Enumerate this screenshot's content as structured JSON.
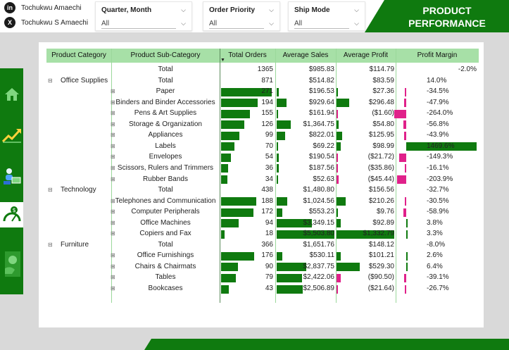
{
  "social": [
    {
      "icon": "linkedin-icon",
      "glyph": "in",
      "name": "Tochukwu Amaechi"
    },
    {
      "icon": "x-icon",
      "glyph": "X",
      "name": "Tochukwu S Amaechi"
    }
  ],
  "slicers": [
    {
      "title": "Quarter, Month",
      "value": "All"
    },
    {
      "title": "Order Priority",
      "value": "All"
    },
    {
      "title": "Ship Mode",
      "value": "All"
    }
  ],
  "banner": {
    "line1": "PRODUCT",
    "line2": "PERFORMANCE"
  },
  "nav": [
    "home-icon",
    "trend-up-icon",
    "customer-icon",
    "speedometer-icon",
    "profit-icon"
  ],
  "colors": {
    "accent": "#0f7a0f",
    "header": "#a7e0a7",
    "negative_bar": "#e0218a"
  },
  "table": {
    "columns": [
      "Product Category",
      "Product Sub-Category",
      "Total Orders",
      "Average Sales",
      "Average Profit",
      "Profit Margin"
    ],
    "sorted_column": "Total Orders",
    "rows": [
      {
        "cat": "",
        "exp": "",
        "sub": "Total",
        "orders": "1365",
        "sales": "$985.83",
        "profit": "$114.79",
        "margin": "-2.0%",
        "kind": "grand"
      },
      {
        "cat": "Office Supplies",
        "exp": "⊟",
        "sub": "Total",
        "orders": "871",
        "sales": "$514.82",
        "profit": "$83.59",
        "margin": "14.0%",
        "kind": "total"
      },
      {
        "cat": "",
        "exp": "⊞",
        "sub": "Paper",
        "orders": "271",
        "sales": "$196.53",
        "profit": "$27.36",
        "margin": "-34.5%",
        "kind": "item",
        "o": 271,
        "s": 196.53,
        "p": 27.36,
        "m": -34.5
      },
      {
        "cat": "",
        "exp": "⊞",
        "sub": "Binders and Binder Accessories",
        "orders": "194",
        "sales": "$929.64",
        "profit": "$296.48",
        "margin": "-47.9%",
        "kind": "item",
        "o": 194,
        "s": 929.64,
        "p": 296.48,
        "m": -47.9
      },
      {
        "cat": "",
        "exp": "⊞",
        "sub": "Pens & Art Supplies",
        "orders": "155",
        "sales": "$161.94",
        "profit": "($1.60)",
        "margin": "-264.0%",
        "kind": "item",
        "o": 155,
        "s": 161.94,
        "p": -1.6,
        "m": -264.0
      },
      {
        "cat": "",
        "exp": "⊞",
        "sub": "Storage & Organization",
        "orders": "126",
        "sales": "$1,364.75",
        "profit": "$54.80",
        "margin": "-56.8%",
        "kind": "item",
        "o": 126,
        "s": 1364.75,
        "p": 54.8,
        "m": -56.8
      },
      {
        "cat": "",
        "exp": "⊞",
        "sub": "Appliances",
        "orders": "99",
        "sales": "$822.01",
        "profit": "$125.95",
        "margin": "-43.9%",
        "kind": "item",
        "o": 99,
        "s": 822.01,
        "p": 125.95,
        "m": -43.9
      },
      {
        "cat": "",
        "exp": "⊞",
        "sub": "Labels",
        "orders": "70",
        "sales": "$69.22",
        "profit": "$98.99",
        "margin": "1469.6%",
        "kind": "item",
        "o": 70,
        "s": 69.22,
        "p": 98.99,
        "m": 1469.6
      },
      {
        "cat": "",
        "exp": "⊞",
        "sub": "Envelopes",
        "orders": "54",
        "sales": "$190.54",
        "profit": "($21.72)",
        "margin": "-149.3%",
        "kind": "item",
        "o": 54,
        "s": 190.54,
        "p": -21.72,
        "m": -149.3
      },
      {
        "cat": "",
        "exp": "⊞",
        "sub": "Scissors, Rulers and Trimmers",
        "orders": "36",
        "sales": "$187.56",
        "profit": "($35.86)",
        "margin": "-16.1%",
        "kind": "item",
        "o": 36,
        "s": 187.56,
        "p": -35.86,
        "m": -16.1
      },
      {
        "cat": "",
        "exp": "⊞",
        "sub": "Rubber Bands",
        "orders": "34",
        "sales": "$52.63",
        "profit": "($45.44)",
        "margin": "-203.9%",
        "kind": "item",
        "o": 34,
        "s": 52.63,
        "p": -45.44,
        "m": -203.9
      },
      {
        "cat": "Technology",
        "exp": "⊟",
        "sub": "Total",
        "orders": "438",
        "sales": "$1,480.80",
        "profit": "$156.56",
        "margin": "-32.7%",
        "kind": "total"
      },
      {
        "cat": "",
        "exp": "⊞",
        "sub": "Telephones and Communication",
        "orders": "188",
        "sales": "$1,024.56",
        "profit": "$210.26",
        "margin": "-30.5%",
        "kind": "item",
        "o": 188,
        "s": 1024.56,
        "p": 210.26,
        "m": -30.5
      },
      {
        "cat": "",
        "exp": "⊞",
        "sub": "Computer Peripherals",
        "orders": "172",
        "sales": "$553.23",
        "profit": "$9.76",
        "margin": "-58.9%",
        "kind": "item",
        "o": 172,
        "s": 553.23,
        "p": 9.76,
        "m": -58.9
      },
      {
        "cat": "",
        "exp": "⊞",
        "sub": "Office Machines",
        "orders": "94",
        "sales": "$3,349.15",
        "profit": "$92.89",
        "margin": "3.8%",
        "kind": "item",
        "o": 94,
        "s": 3349.15,
        "p": 92.89,
        "m": 3.8
      },
      {
        "cat": "",
        "exp": "⊞",
        "sub": "Copiers and Fax",
        "orders": "18",
        "sales": "$5,503.80",
        "profit": "$1,332.79",
        "margin": "3.3%",
        "kind": "item",
        "o": 18,
        "s": 5503.8,
        "p": 1332.79,
        "m": 3.3
      },
      {
        "cat": "Furniture",
        "exp": "⊟",
        "sub": "Total",
        "orders": "366",
        "sales": "$1,651.76",
        "profit": "$148.12",
        "margin": "-8.0%",
        "kind": "total"
      },
      {
        "cat": "",
        "exp": "⊞",
        "sub": "Office Furnishings",
        "orders": "176",
        "sales": "$530.11",
        "profit": "$101.21",
        "margin": "2.6%",
        "kind": "item",
        "o": 176,
        "s": 530.11,
        "p": 101.21,
        "m": 2.6
      },
      {
        "cat": "",
        "exp": "⊞",
        "sub": "Chairs & Chairmats",
        "orders": "90",
        "sales": "$2,837.75",
        "profit": "$529.30",
        "margin": "6.4%",
        "kind": "item",
        "o": 90,
        "s": 2837.75,
        "p": 529.3,
        "m": 6.4
      },
      {
        "cat": "",
        "exp": "⊞",
        "sub": "Tables",
        "orders": "79",
        "sales": "$2,422.06",
        "profit": "($90.50)",
        "margin": "-39.1%",
        "kind": "item",
        "o": 79,
        "s": 2422.06,
        "p": -90.5,
        "m": -39.1
      },
      {
        "cat": "",
        "exp": "⊞",
        "sub": "Bookcases",
        "orders": "43",
        "sales": "$2,506.89",
        "profit": "($21.64)",
        "margin": "-26.7%",
        "kind": "item",
        "o": 43,
        "s": 2506.89,
        "p": -21.64,
        "m": -26.7
      }
    ]
  }
}
